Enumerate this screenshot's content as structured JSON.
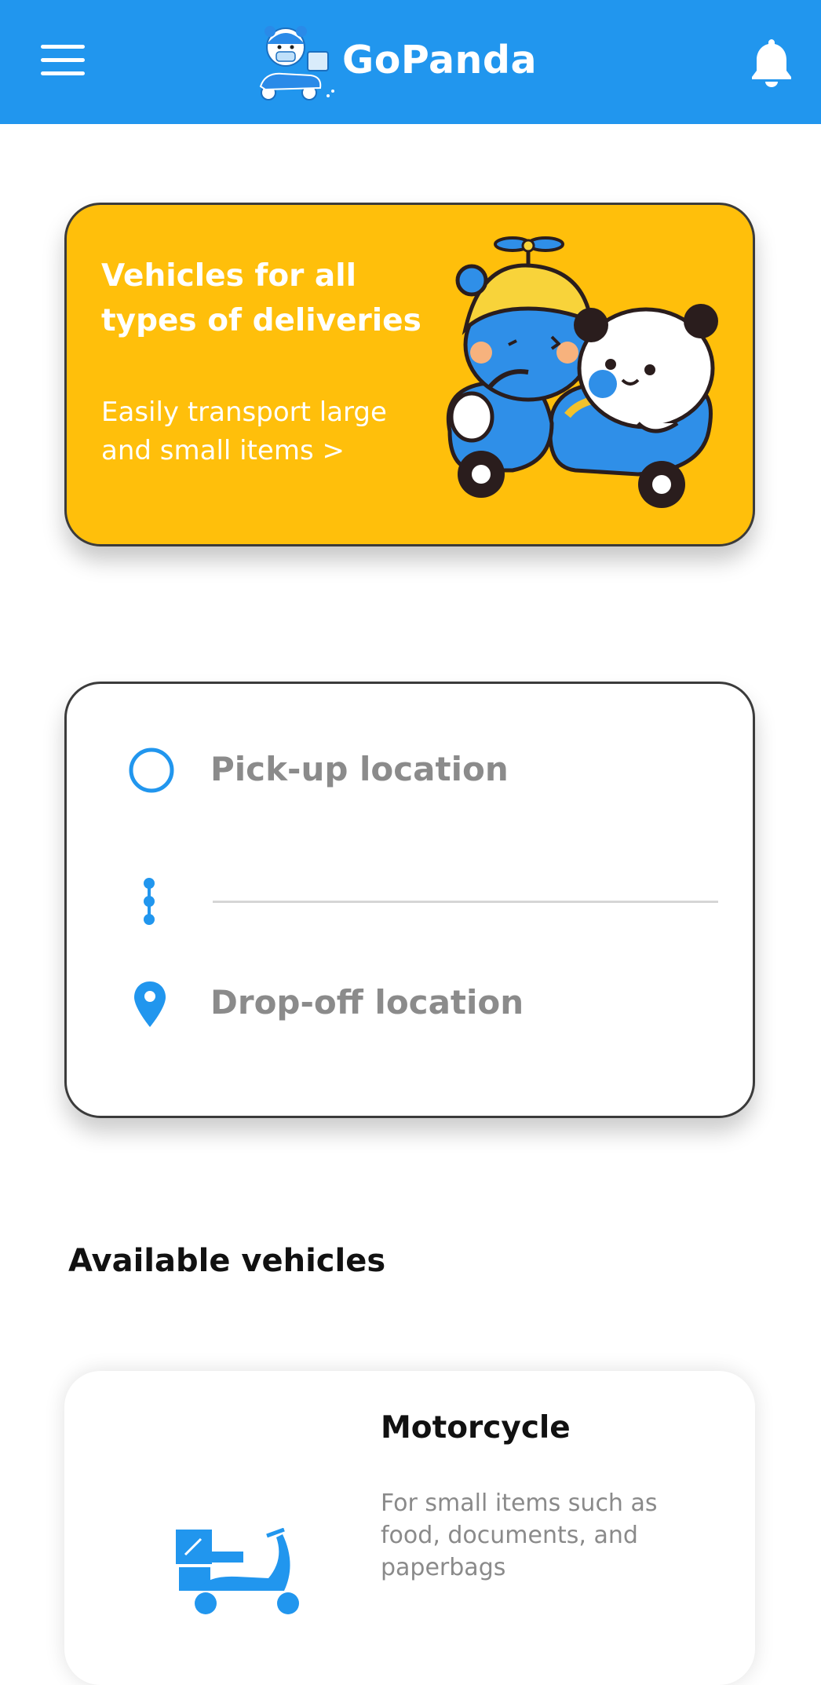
{
  "header": {
    "brand": "GoPanda",
    "menu_icon": "hamburger-menu-icon",
    "notification_icon": "bell-icon",
    "color": "#2196EE"
  },
  "promo": {
    "title": "Vehicles for all types of deliveries",
    "subtitle": "Easily transport large and small items >",
    "color": "#FFBF0B"
  },
  "route": {
    "pickup_placeholder": "Pick-up location",
    "dropoff_placeholder": "Drop-off location",
    "pickup_icon": "circle-outline-icon",
    "route_icon": "route-dots-icon",
    "dropoff_icon": "location-pin-icon"
  },
  "vehicles_section": {
    "title": "Available vehicles",
    "items": [
      {
        "name": "Motorcycle",
        "description": "For small items such as food, documents, and paperbags",
        "icon": "delivery-scooter-icon"
      }
    ]
  }
}
